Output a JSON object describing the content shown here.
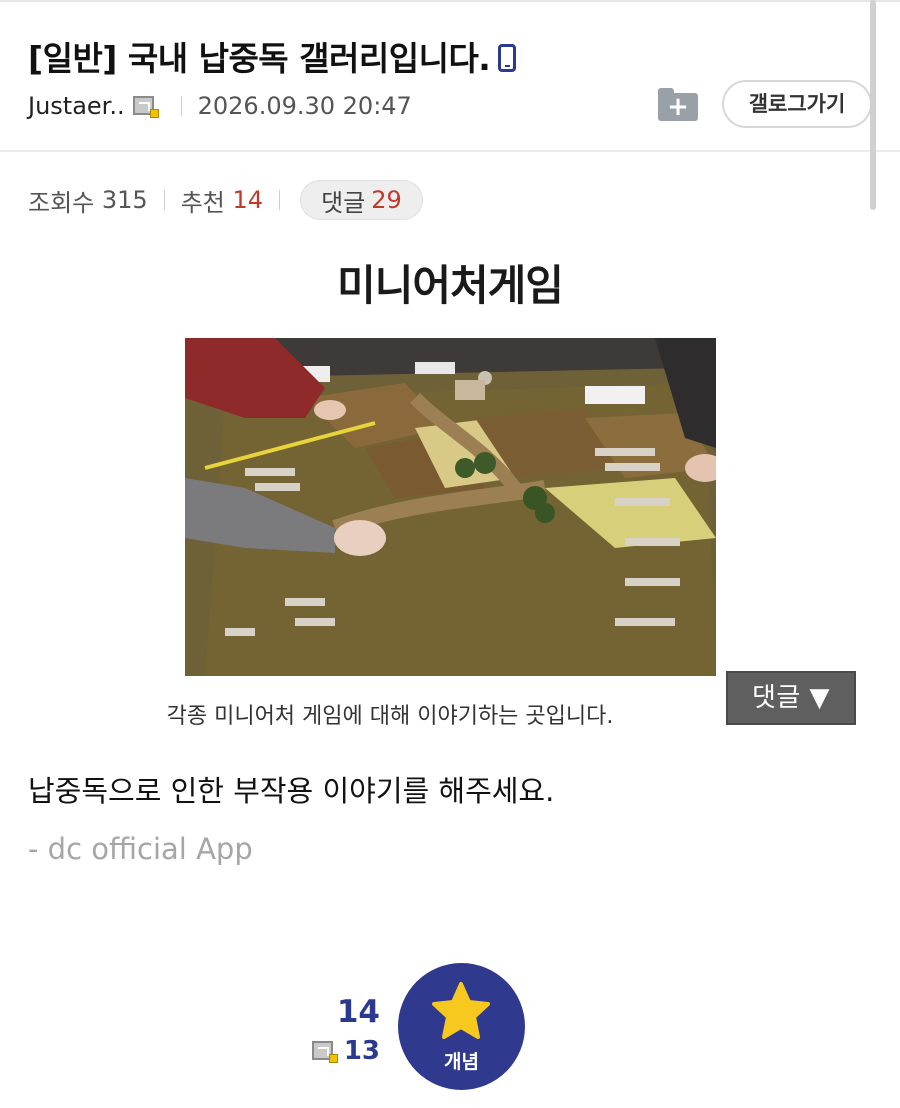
{
  "post": {
    "title": "[일반] 국내 납중독 갤러리입니다.",
    "author": "Justaer..",
    "datetime": "2026.09.30 20:47",
    "gallery_button": "갤로그가기",
    "folder_button": "+"
  },
  "stats": {
    "views_label": "조회수",
    "views": "315",
    "recommend_label": "추천",
    "recommend": "14",
    "comments_label": "댓글",
    "comments": "29"
  },
  "content": {
    "image_title": "미니어처게임",
    "image_caption": "각종 미니어처 게임에 대해 이야기하는 곳입니다.",
    "comment_jump_button": "댓글 ▼",
    "body_text": "납중독으로 인한 부작용 이야기를 해주세요.",
    "signature": "- dc official App"
  },
  "recommend_box": {
    "recommend_count": "14",
    "fixed_count": "13",
    "concept_label": "개념"
  },
  "colors": {
    "accent": "#2f3a8f",
    "count_red": "#c0392b",
    "star": "#f7c81e"
  },
  "icons": [
    "mobile-icon",
    "user-badge-icon",
    "folder-add-icon",
    "star-icon"
  ]
}
